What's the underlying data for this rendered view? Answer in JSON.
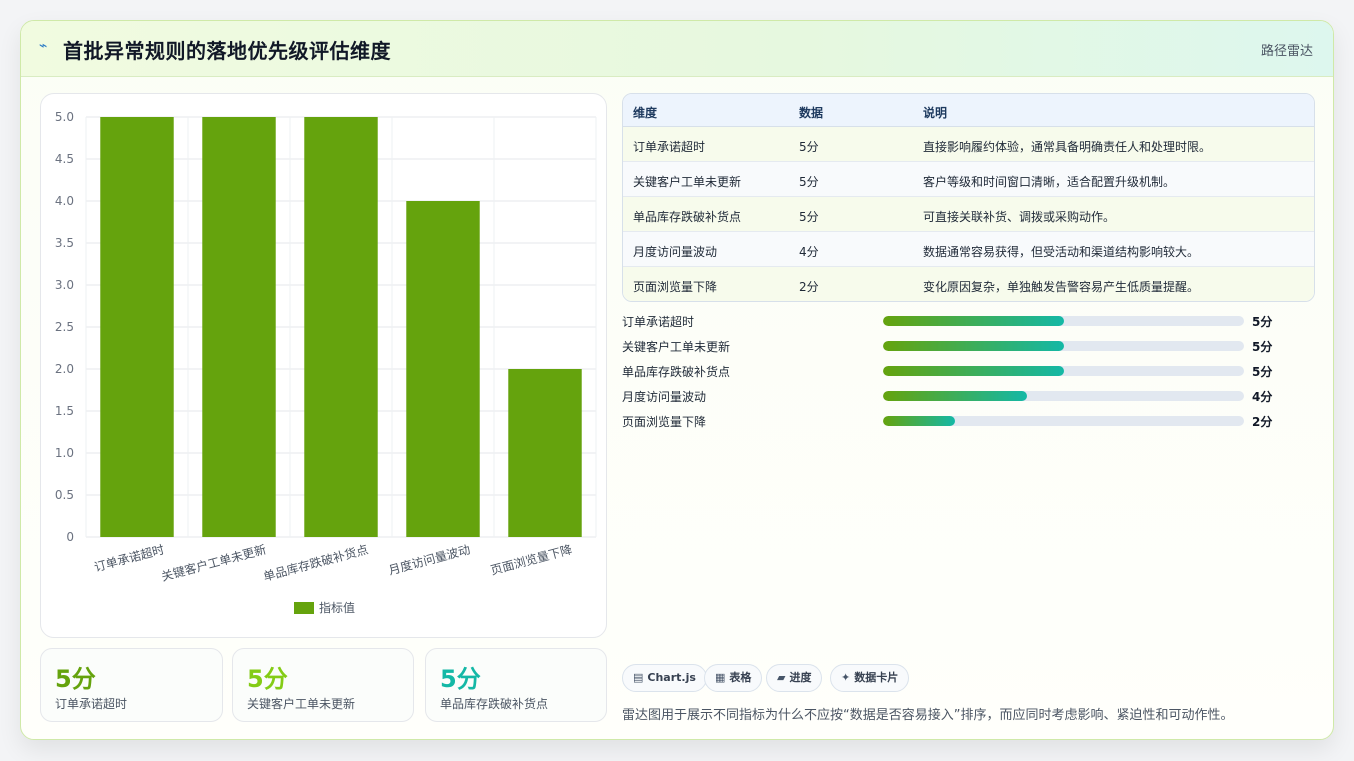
{
  "header": {
    "icon": "lightning-icon",
    "title": "首批异常规则的落地优先级评估维度",
    "badge": "路径雷达"
  },
  "chart_data": {
    "type": "bar",
    "categories": [
      "订单承诺超时",
      "关键客户工单未更新",
      "单品库存跌破补货点",
      "月度访问量波动",
      "页面浏览量下降"
    ],
    "series": [
      {
        "name": "指标值",
        "values": [
          5,
          5,
          5,
          4,
          2
        ],
        "color": "#65a30d"
      }
    ],
    "ylim": [
      0,
      5
    ],
    "yticks": [
      "0",
      "0.5",
      "1.0",
      "1.5",
      "2.0",
      "2.5",
      "3.0",
      "3.5",
      "4.0",
      "4.5",
      "5.0"
    ],
    "grid": true,
    "legend_position": "bottom"
  },
  "stats": [
    {
      "value": "5分",
      "label": "订单承诺超时",
      "color": "#65a30d"
    },
    {
      "value": "5分",
      "label": "关键客户工单未更新",
      "color": "#84cc16"
    },
    {
      "value": "5分",
      "label": "单品库存跌破补货点",
      "color": "#14b8a6"
    }
  ],
  "table": {
    "headers": [
      "维度",
      "数据",
      "说明"
    ],
    "rows": [
      [
        "订单承诺超时",
        "5分",
        "直接影响履约体验，通常具备明确责任人和处理时限。"
      ],
      [
        "关键客户工单未更新",
        "5分",
        "客户等级和时间窗口清晰，适合配置升级机制。"
      ],
      [
        "单品库存跌破补货点",
        "5分",
        "可直接关联补货、调拨或采购动作。"
      ],
      [
        "月度访问量波动",
        "4分",
        "数据通常容易获得，但受活动和渠道结构影响较大。"
      ],
      [
        "页面浏览量下降",
        "2分",
        "变化原因复杂，单独触发告警容易产生低质量提醒。"
      ]
    ]
  },
  "progress": [
    {
      "name": "订单承诺超时",
      "score": "5分",
      "fraction": 0.5
    },
    {
      "name": "关键客户工单未更新",
      "score": "5分",
      "fraction": 0.5
    },
    {
      "name": "单品库存跌破补货点",
      "score": "5分",
      "fraction": 0.5
    },
    {
      "name": "月度访问量波动",
      "score": "4分",
      "fraction": 0.4
    },
    {
      "name": "页面浏览量下降",
      "score": "2分",
      "fraction": 0.2
    }
  ],
  "tags": [
    {
      "icon": "chart-icon",
      "label": "Chart.js"
    },
    {
      "icon": "table-icon",
      "label": "表格"
    },
    {
      "icon": "progress-icon",
      "label": "进度"
    },
    {
      "icon": "card-icon",
      "label": "数据卡片"
    }
  ],
  "note": "雷达图用于展示不同指标为什么不应按“数据是否容易接入”排序，而应同时考虑影响、紧迫性和可动作性。"
}
